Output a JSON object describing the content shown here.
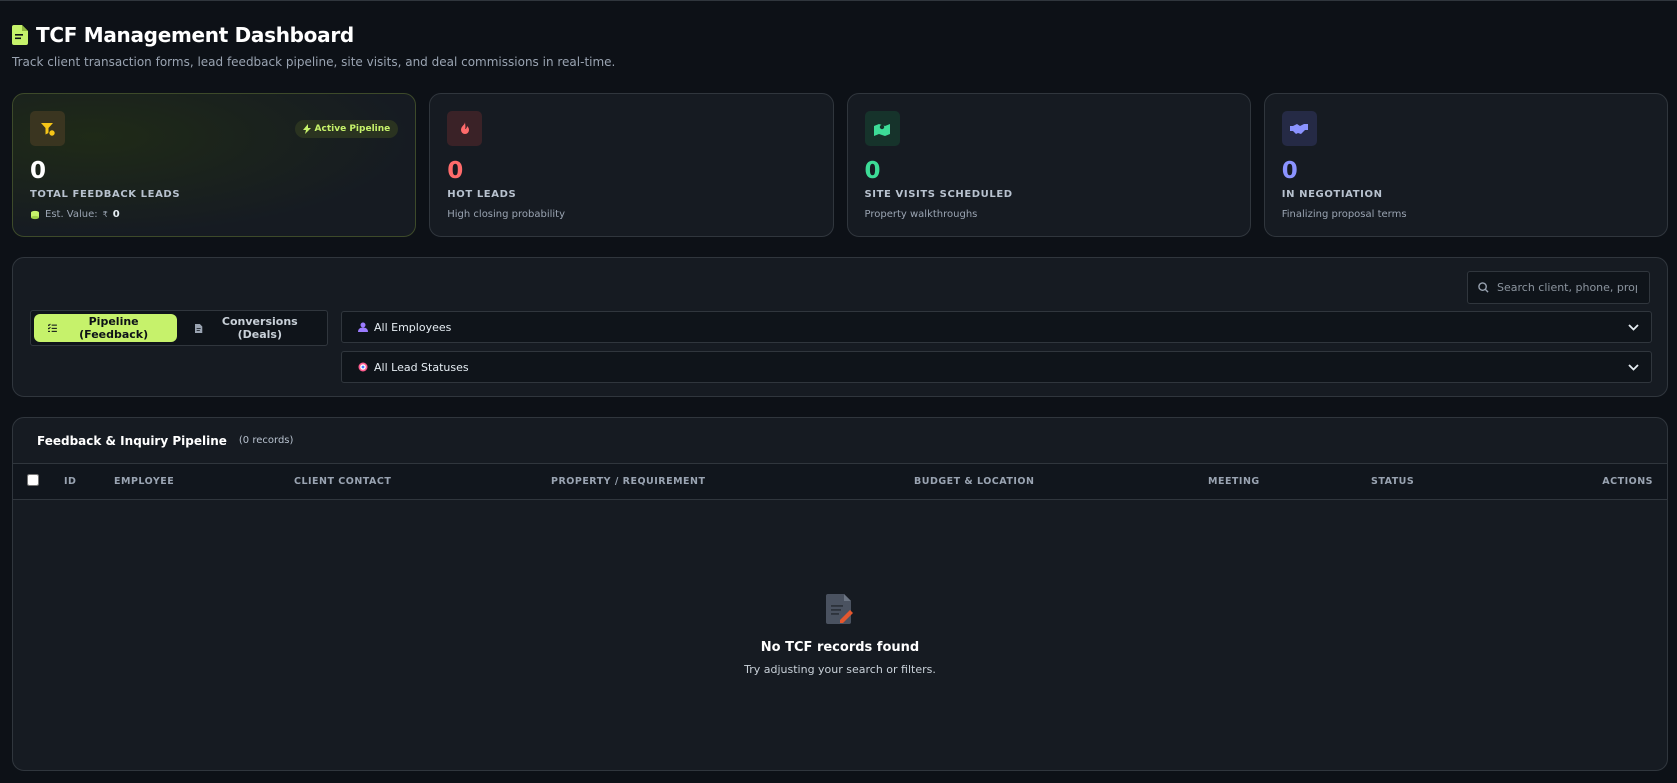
{
  "header": {
    "title": "TCF Management Dashboard",
    "subtitle": "Track client transaction forms, lead feedback pipeline, site visits, and deal commissions in real-time."
  },
  "stats": [
    {
      "value": "0",
      "label": "TOTAL FEEDBACK LEADS",
      "sub_prefix": "Est. Value:",
      "sub_currency": "₹",
      "sub_value": "0",
      "badge": "Active Pipeline",
      "color": "#ffffff",
      "icon": "filter-coin-icon"
    },
    {
      "value": "0",
      "label": "HOT LEADS",
      "sub": "High closing probability",
      "color": "#ff6b6b",
      "icon": "flame-icon"
    },
    {
      "value": "0",
      "label": "SITE VISITS SCHEDULED",
      "sub": "Property walkthroughs",
      "color": "#3ddc97",
      "icon": "map-pin-icon"
    },
    {
      "value": "0",
      "label": "IN NEGOTIATION",
      "sub": "Finalizing proposal terms",
      "color": "#8b93ff",
      "icon": "handshake-icon"
    }
  ],
  "filters": {
    "search_placeholder": "Search client, phone, property",
    "tabs": [
      {
        "label": "Pipeline (Feedback)",
        "active": true
      },
      {
        "label": "Conversions (Deals)",
        "active": false
      }
    ],
    "employee_select": "All Employees",
    "status_select": "All Lead Statuses"
  },
  "table": {
    "title": "Feedback & Inquiry Pipeline",
    "count": "(0 records)",
    "columns": [
      "ID",
      "EMPLOYEE",
      "CLIENT CONTACT",
      "PROPERTY / REQUIREMENT",
      "BUDGET & LOCATION",
      "MEETING",
      "STATUS",
      "ACTIONS"
    ],
    "empty_title": "No TCF records found",
    "empty_sub": "Try adjusting your search or filters."
  },
  "colors": {
    "accent": "#c6f26b",
    "background": "#0d1117",
    "card": "#161b22"
  }
}
